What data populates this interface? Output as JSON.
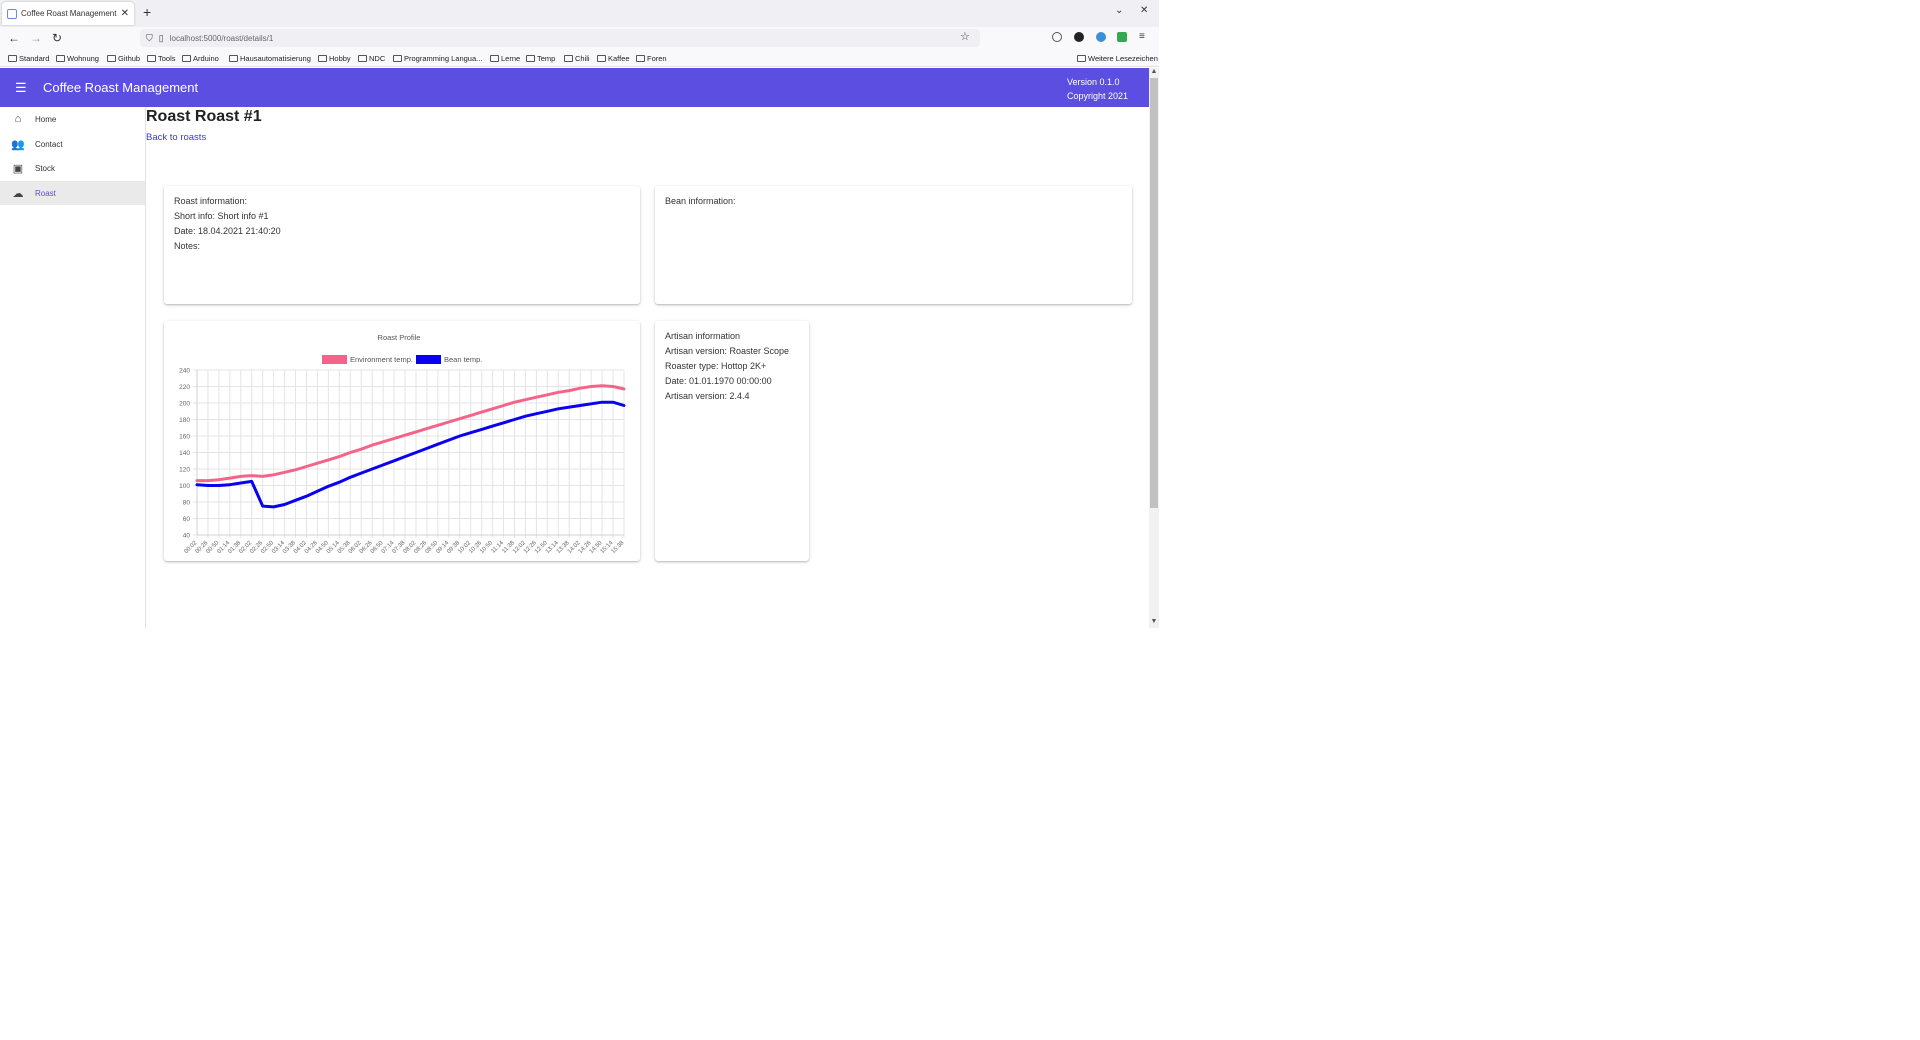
{
  "browser": {
    "tab_title": "Coffee Roast Management",
    "url": "localhost:5000/roast/details/1",
    "bookmarks": [
      "Standard",
      "Wohnung",
      "Github",
      "Tools",
      "Arduino",
      "Hausautomatisierung",
      "Hobby",
      "NDC",
      "Programming Langua...",
      "Lerne",
      "Temp",
      "Chili",
      "Kaffee",
      "Foren"
    ],
    "other_bookmarks": "Weitere Lesezeichen"
  },
  "app": {
    "title": "Coffee Roast Management",
    "version": "Version 0.1.0",
    "copyright": "Copyright 2021"
  },
  "sidebar": {
    "items": [
      {
        "label": "Home",
        "icon": "home-icon"
      },
      {
        "label": "Contact",
        "icon": "people-icon"
      },
      {
        "label": "Stock",
        "icon": "box-icon"
      },
      {
        "label": "Roast",
        "icon": "cloud-icon",
        "active": true
      }
    ]
  },
  "page": {
    "title": "Roast Roast #1",
    "back_link": "Back to roasts"
  },
  "roast_info": {
    "heading": "Roast information:",
    "short_info": "Short info: Short info #1",
    "date": "Date: 18.04.2021 21:40:20",
    "notes": "Notes:"
  },
  "bean_info": {
    "heading": "Bean information:"
  },
  "artisan_info": {
    "heading": "Artisan information",
    "artisan_version": "Artisan version: Roaster Scope",
    "roaster_type": "Roaster type: Hottop 2K+",
    "date": "Date: 01.01.1970 00:00:00",
    "artisan_version2": "Artisan version: 2.4.4"
  },
  "chart_data": {
    "type": "line",
    "title": "Roast Profile",
    "xlabel": "",
    "ylabel": "",
    "ylim": [
      40,
      240
    ],
    "yticks": [
      40,
      60,
      80,
      100,
      120,
      140,
      160,
      180,
      200,
      220,
      240
    ],
    "grid": true,
    "legend_position": "top",
    "x": [
      "00:02",
      "00:26",
      "00:50",
      "01:14",
      "01:38",
      "02:02",
      "02:26",
      "02:50",
      "03:14",
      "03:38",
      "04:02",
      "04:26",
      "04:50",
      "05:14",
      "05:38",
      "06:02",
      "06:26",
      "06:50",
      "07:14",
      "07:38",
      "08:02",
      "08:26",
      "08:50",
      "09:14",
      "09:38",
      "10:02",
      "10:26",
      "10:50",
      "11:14",
      "11:38",
      "12:02",
      "12:26",
      "12:50",
      "13:14",
      "13:38",
      "14:02",
      "14:26",
      "14:50",
      "15:14",
      "15:38"
    ],
    "series": [
      {
        "name": "Environment temp.",
        "color": "#f4648a",
        "values": [
          106,
          106,
          107,
          109,
          111,
          112,
          111,
          113,
          116,
          119,
          123,
          127,
          131,
          135,
          140,
          144,
          149,
          153,
          157,
          161,
          165,
          169,
          173,
          177,
          181,
          185,
          189,
          193,
          197,
          201,
          204,
          207,
          210,
          213,
          215,
          218,
          220,
          221,
          220,
          217
        ]
      },
      {
        "name": "Bean temp.",
        "color": "#0a00f0",
        "values": [
          101,
          100,
          100,
          101,
          103,
          105,
          75,
          74,
          77,
          82,
          87,
          93,
          99,
          104,
          110,
          115,
          120,
          125,
          130,
          135,
          140,
          145,
          150,
          155,
          160,
          164,
          168,
          172,
          176,
          180,
          184,
          187,
          190,
          193,
          195,
          197,
          199,
          201,
          201,
          197
        ]
      }
    ]
  },
  "colors": {
    "primary": "#5b4ee0",
    "link": "#3a3ad8"
  }
}
